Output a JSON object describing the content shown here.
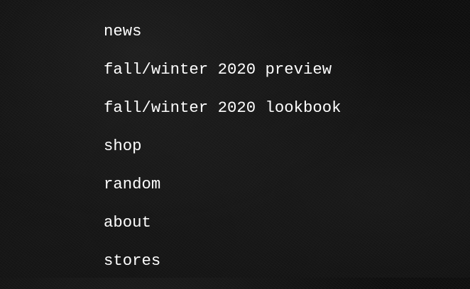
{
  "nav": {
    "items": [
      {
        "label": "news"
      },
      {
        "label": "fall/winter 2020 preview"
      },
      {
        "label": "fall/winter 2020 lookbook"
      },
      {
        "label": "shop"
      },
      {
        "label": "random"
      },
      {
        "label": "about"
      },
      {
        "label": "stores"
      }
    ]
  },
  "colors": {
    "background": "#101010",
    "text": "#ffffff"
  }
}
